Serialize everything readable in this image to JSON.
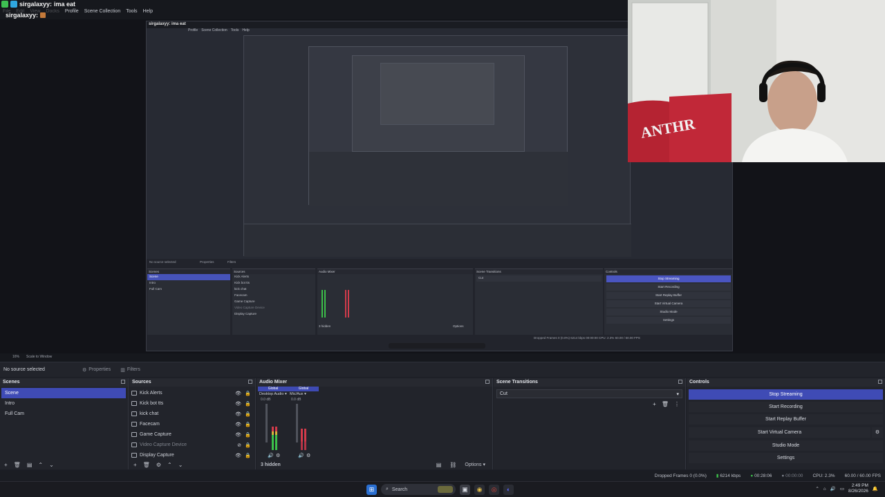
{
  "overlay": {
    "chat_user": "sirgalaxyy:",
    "chat_message": "ima eat",
    "chat_user_2": "sirgalaxyy:"
  },
  "menubar": {
    "items": [
      "File",
      "Edit",
      "View",
      "Docks",
      "Profile",
      "Scene Collection",
      "Tools",
      "Help"
    ]
  },
  "nested_preview": {
    "title_user": "sirgalaxyy:",
    "title_msg": "ima eat",
    "no_source": "No source selected",
    "properties": "Properties",
    "filters": "Filters",
    "scenes_head": "Scenes",
    "sources_head": "Sources",
    "mixer_head": "Audio Mixer",
    "transitions_head": "Scene Transitions",
    "controls_head": "Controls",
    "scenes": [
      "Scene",
      "Intro",
      "Full Cam"
    ],
    "sources": [
      "Kick Alerts",
      "Kick bot tts",
      "kick chat",
      "Facecam",
      "Game Capture",
      "Video Capture Device",
      "Display Capture"
    ],
    "controls": [
      "Stop Streaming",
      "Start Recording",
      "Start Replay Buffer",
      "Start Virtual Camera",
      "Studio Mode",
      "Settings"
    ],
    "transition": "Cut",
    "hidden": "3 hidden",
    "options": "Options",
    "status": "Dropped Frames 0 (0.0%)   6214 kbps   00:00:00   CPU: 2.3%   60.00 / 60.00 FPS"
  },
  "scale_row": {
    "zoom": "16%",
    "scale": "Scale to Window"
  },
  "properties_row": {
    "no_source": "No source selected",
    "properties": "Properties",
    "filters": "Filters"
  },
  "scenes": {
    "title": "Scenes",
    "items": [
      "Scene",
      "Intro",
      "Full Cam"
    ]
  },
  "sources": {
    "title": "Sources",
    "items": [
      "Kick Alerts",
      "Kick bot tts",
      "kick chat",
      "Facecam",
      "Game Capture",
      "Video Capture Device",
      "Display Capture"
    ]
  },
  "mixer": {
    "title": "Audio Mixer",
    "channels": [
      {
        "global": "Global",
        "name": "Desktop Audio",
        "db": "0.0 dB",
        "level": 0.55
      },
      {
        "global": "Global",
        "name": "Mic/Aux",
        "db": "0.0 dB",
        "level": 0.5
      }
    ],
    "hidden": "3 hidden",
    "options": "Options"
  },
  "transitions": {
    "title": "Scene Transitions",
    "selected": "Cut"
  },
  "controls": {
    "title": "Controls",
    "stop_streaming": "Stop Streaming",
    "start_recording": "Start Recording",
    "start_replay": "Start Replay Buffer",
    "start_virtual": "Start Virtual Camera",
    "studio_mode": "Studio Mode",
    "settings": "Settings"
  },
  "statusbar": {
    "dropped": "Dropped Frames 0 (0.0%)",
    "kbps": "6214 kbps",
    "stream_time": "00:28:06",
    "rec_time": "00:00:00",
    "cpu": "CPU: 2.3%",
    "fps": "60.00 / 60.00 FPS"
  },
  "taskbar": {
    "search_placeholder": "Search",
    "time": "2:49 PM",
    "date": "8/26/2026"
  },
  "colors": {
    "accent": "#3f4bb5",
    "panel": "#22242b",
    "meter_green": "#3cbf4a",
    "meter_red": "#d23b4b"
  }
}
